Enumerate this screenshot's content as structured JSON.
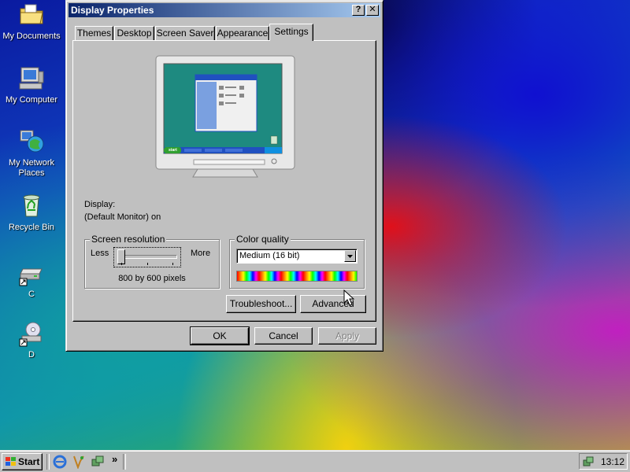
{
  "desktop": {
    "icons": [
      {
        "label": "My Documents"
      },
      {
        "label": "My Computer"
      },
      {
        "label": "My Network Places"
      },
      {
        "label": "Recycle Bin"
      },
      {
        "label": "C"
      },
      {
        "label": "D"
      }
    ]
  },
  "window": {
    "title": "Display Properties",
    "help_glyph": "?",
    "close_glyph": "✕",
    "tabs": [
      {
        "label": "Themes"
      },
      {
        "label": "Desktop"
      },
      {
        "label": "Screen Saver"
      },
      {
        "label": "Appearance"
      },
      {
        "label": "Settings"
      }
    ],
    "active_tab": "Settings",
    "settings": {
      "display_label": "Display:",
      "display_value": "(Default Monitor) on",
      "resolution": {
        "legend": "Screen resolution",
        "less": "Less",
        "more": "More",
        "value": "800 by 600 pixels"
      },
      "color_quality": {
        "legend": "Color quality",
        "selected": "Medium (16 bit)"
      },
      "troubleshoot_label": "Troubleshoot...",
      "advanced_label": "Advanced"
    },
    "buttons": {
      "ok": "OK",
      "cancel": "Cancel",
      "apply": "Apply"
    }
  },
  "preview": {
    "start_label": "start"
  },
  "taskbar": {
    "start_label": "Start",
    "chevron": "»",
    "clock": "13:12"
  },
  "colors": {
    "title_active_start": "#0a246a",
    "title_active_end": "#a6caf0",
    "face": "#c0c0c0",
    "preview_desktop": "#1e8a80"
  }
}
